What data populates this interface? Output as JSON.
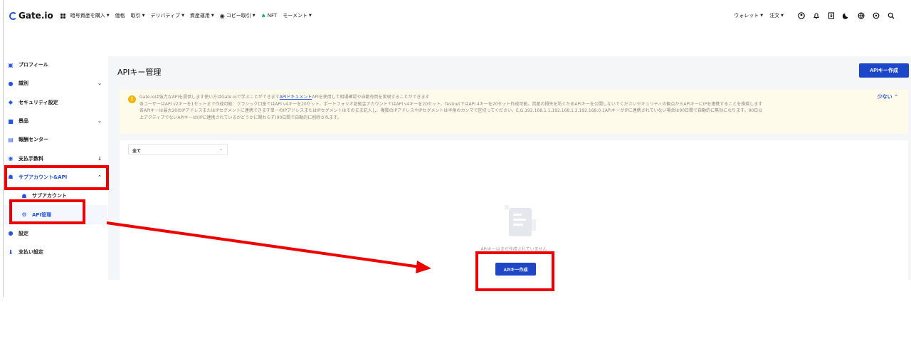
{
  "header": {
    "logo_text": "Gate.io",
    "nav_items": [
      "暗号資産を購入",
      "価格",
      "取引",
      "デリバティブ",
      "資産運用",
      "コピー取引",
      "NFT",
      "モーメント"
    ],
    "right_items": [
      "ウォレット",
      "注文"
    ]
  },
  "sidebar": {
    "items": [
      {
        "label": "プロフィール",
        "icon": "profile-icon"
      },
      {
        "label": "識別",
        "icon": "identity-icon",
        "chev": "⌄"
      },
      {
        "label": "セキュリティ設定",
        "icon": "shield-icon"
      },
      {
        "label": "景品",
        "icon": "gift-icon",
        "chev": "⌄"
      },
      {
        "label": "報酬センター",
        "icon": "reward-icon"
      },
      {
        "label": "支払手数料",
        "icon": "fee-icon",
        "chev": "↓"
      },
      {
        "label": "サブアカウント&API",
        "icon": "subaccount-icon",
        "chev": "⌃"
      },
      {
        "label": "サブアカウント",
        "icon": "subaccount-sub-icon"
      },
      {
        "label": "API管理",
        "icon": "api-icon"
      },
      {
        "label": "設定",
        "icon": "settings-icon"
      },
      {
        "label": "支払い設定",
        "icon": "payment-icon"
      }
    ]
  },
  "main": {
    "title": "APIキー管理",
    "create_button": "APIキー作成",
    "notice": {
      "line1_pre": "Gate.ioは強力なAPIを提供します使い方はGate.ioで学ぶことができます",
      "line1_link": "APIドキュメント",
      "line1_post": "APIを使用して相場確認や自動売買を実現することができます",
      "line2": "各ユーザーはAPI v2キーを1セットまで作成可能：クラシック口座ではAPI v4キーを20セット、ポートフォリオ証拠金アカウントではAPI v4キーを20セット、TestnetではAPI 4キーを20セット作成可能。資産の損失を防ぐためAPIキーを公開しないでくださいセキュリティの観点からAPIキーにIPを連携することを推奨します",
      "line3": "各APIキーは最大20のIPアドレスまたはIPセグメントに連携できます単一のIPアドレスまたはIPセグメントはそのまま記入し、複数のIPアドレスやIPセグメントは半角のカンマで区切ってください。E.G.192.168.1.1,192.168.1.2,192.168.0.1APIキーがIPに連携されていない場合は90日間で自動的に無効になります。90日以",
      "line4": "上アクティブでないAPIキーは(IPに連携されているかどうかに関わらず)90日間で自動的に削除されます。",
      "less": "少ない"
    },
    "filter_value": "全て",
    "empty_text": "APIキーはまだ作成されていません",
    "create_mid_button": "APIキー作成"
  },
  "colors": {
    "accent": "#1d46c8",
    "annotation": "#ee0000",
    "notice_bg": "#fffbea"
  }
}
